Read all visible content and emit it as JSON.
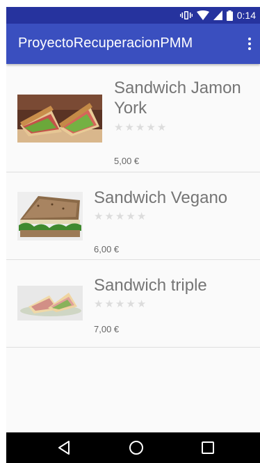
{
  "status_bar": {
    "time": "0:14",
    "icons": [
      "vibrate-icon",
      "wifi-icon",
      "signal-icon",
      "battery-icon"
    ]
  },
  "app_bar": {
    "title": "ProyectoRecuperacionPMM",
    "menu_icon": "overflow-menu-icon"
  },
  "products": [
    {
      "name": "Sandwich Jamon York",
      "rating": 0,
      "max_rating": 5,
      "price": "5,00 €",
      "image": "sandwich-ham-photo"
    },
    {
      "name": "Sandwich Vegano",
      "rating": 0,
      "max_rating": 5,
      "price": "6,00 €",
      "image": "sandwich-vegan-photo"
    },
    {
      "name": "Sandwich triple",
      "rating": 0,
      "max_rating": 5,
      "price": "7,00 €",
      "image": "sandwich-triple-photo"
    }
  ],
  "nav_bar": {
    "buttons": [
      "back-icon",
      "home-icon",
      "recents-icon"
    ]
  },
  "colors": {
    "status_bar": "#26339e",
    "app_bar": "#3a4fbf",
    "background": "#fafafa",
    "star_empty": "#dcdcdc",
    "text_secondary": "#757575"
  }
}
